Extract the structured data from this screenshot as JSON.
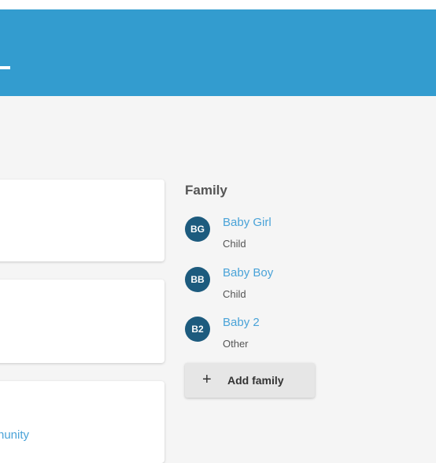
{
  "colors": {
    "header": "#339ccf",
    "link": "#4aa3d8",
    "avatar": "#1d5b7e",
    "button": "#e6e6e6"
  },
  "cards": [
    {
      "link_fragment": ""
    },
    {
      "link_fragment": ""
    },
    {
      "link_fragment": "nunity"
    }
  ],
  "family": {
    "title": "Family",
    "members": [
      {
        "initials": "BG",
        "name": "Baby Girl",
        "relation": "Child"
      },
      {
        "initials": "BB",
        "name": "Baby Boy",
        "relation": "Child"
      },
      {
        "initials": "B2",
        "name": "Baby 2",
        "relation": "Other"
      }
    ],
    "add_button": {
      "icon": "plus-icon",
      "label": "Add family"
    }
  }
}
